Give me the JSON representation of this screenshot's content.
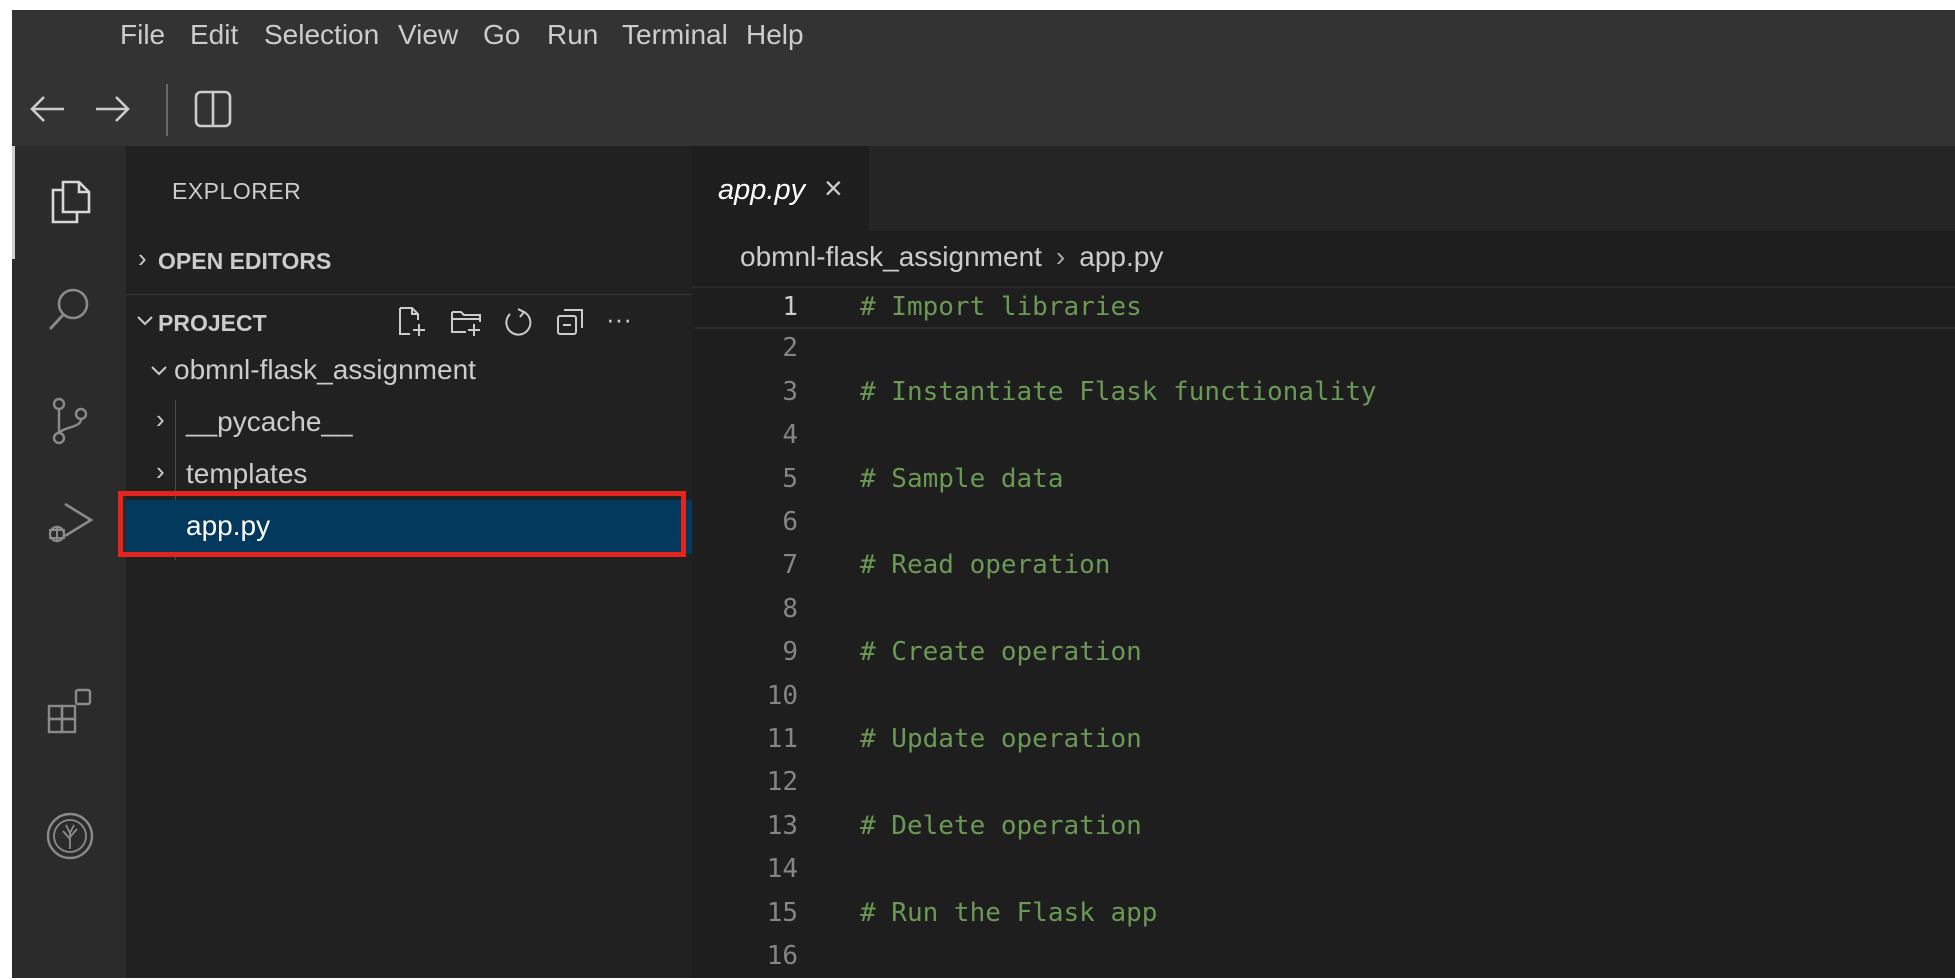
{
  "menubar": {
    "items": [
      "File",
      "Edit",
      "Selection",
      "View",
      "Go",
      "Run",
      "Terminal",
      "Help"
    ]
  },
  "navbar": {
    "back_icon": "arrow-left-icon",
    "forward_icon": "arrow-right-icon",
    "layout_icon": "split-editor-icon"
  },
  "activitybar": {
    "icons": [
      "files-icon",
      "search-icon",
      "source-control-icon",
      "run-debug-icon",
      "extensions-icon",
      "tree-logo-icon"
    ]
  },
  "sidebar": {
    "title": "EXPLORER",
    "open_editors_label": "OPEN EDITORS",
    "project_label": "PROJECT",
    "tools": [
      "new-file-icon",
      "new-folder-icon",
      "refresh-icon",
      "collapse-all-icon",
      "more-icon"
    ],
    "more_glyph": "···",
    "root_folder": "obmnl-flask_assignment",
    "tree": [
      {
        "label": "__pycache__",
        "type": "folder"
      },
      {
        "label": "templates",
        "type": "folder"
      },
      {
        "label": "app.py",
        "type": "file",
        "selected": true
      }
    ]
  },
  "editor": {
    "tab": {
      "label": "app.py",
      "close_glyph": "×"
    },
    "breadcrumb": {
      "folder": "obmnl-flask_assignment",
      "file": "app.py",
      "separator": "›"
    },
    "active_line": 1,
    "lines": [
      {
        "n": "1",
        "text": "# Import libraries"
      },
      {
        "n": "2",
        "text": ""
      },
      {
        "n": "3",
        "text": "# Instantiate Flask functionality"
      },
      {
        "n": "4",
        "text": ""
      },
      {
        "n": "5",
        "text": "# Sample data"
      },
      {
        "n": "6",
        "text": ""
      },
      {
        "n": "7",
        "text": "# Read operation"
      },
      {
        "n": "8",
        "text": ""
      },
      {
        "n": "9",
        "text": "# Create operation"
      },
      {
        "n": "10",
        "text": ""
      },
      {
        "n": "11",
        "text": "# Update operation"
      },
      {
        "n": "12",
        "text": ""
      },
      {
        "n": "13",
        "text": "# Delete operation"
      },
      {
        "n": "14",
        "text": ""
      },
      {
        "n": "15",
        "text": "# Run the Flask app"
      },
      {
        "n": "16",
        "text": ""
      }
    ]
  },
  "colors": {
    "selection": "#04395e",
    "highlight_border": "#e2261e",
    "comment": "#6a9955"
  }
}
